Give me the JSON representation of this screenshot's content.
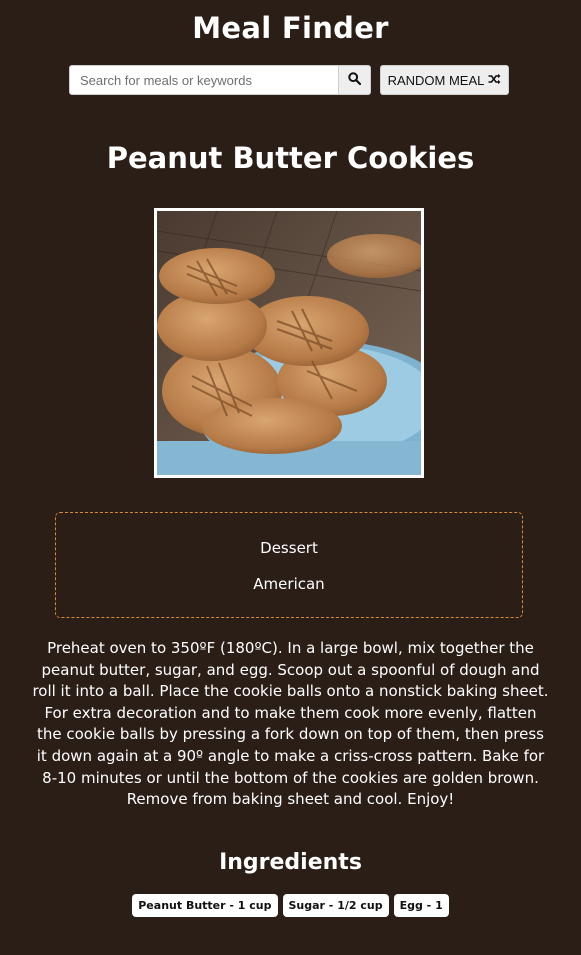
{
  "header": {
    "title": "Meal Finder",
    "search_placeholder": "Search for meals or keywords",
    "search_icon": "search-icon",
    "random_label": "RANDOM MEAL",
    "random_icon": "shuffle-icon"
  },
  "meal": {
    "title": "Peanut Butter Cookies",
    "image_alt": "Peanut Butter Cookies",
    "category": "Dessert",
    "area": "American",
    "instructions": "Preheat oven to 350ºF (180ºC). In a large bowl, mix together the peanut butter, sugar, and egg. Scoop out a spoonful of dough and roll it into a ball. Place the cookie balls onto a nonstick baking sheet. For extra decoration and to make them cook more evenly, flatten the cookie balls by pressing a fork down on top of them, then press it down again at a 90º angle to make a criss-cross pattern. Bake for 8-10 minutes or until the bottom of the cookies are golden brown. Remove from baking sheet and cool. Enjoy!",
    "ingredients_title": "Ingredients",
    "ingredients": [
      "Peanut Butter - 1 cup",
      "Sugar - 1/2 cup",
      "Egg - 1"
    ]
  },
  "colors": {
    "background": "#2a1e17",
    "text": "#ffffff",
    "info_border": "#d8893a",
    "button_bg": "#eeeeee"
  }
}
